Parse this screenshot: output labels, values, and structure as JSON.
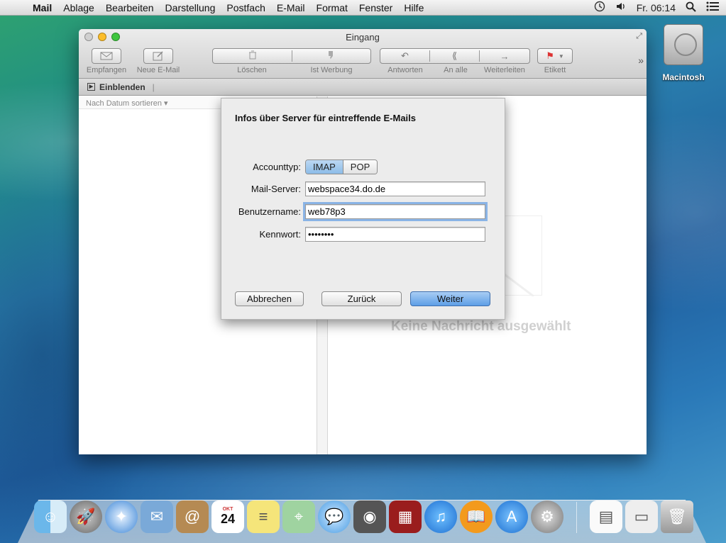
{
  "menubar": {
    "app_name": "Mail",
    "items": [
      "Ablage",
      "Bearbeiten",
      "Darstellung",
      "Postfach",
      "E-Mail",
      "Format",
      "Fenster",
      "Hilfe"
    ],
    "clock": "Fr. 06:14"
  },
  "desktop": {
    "hd_label": "Macintosh"
  },
  "window": {
    "title": "Eingang",
    "toolbar": {
      "receive": "Empfangen",
      "new_mail": "Neue E-Mail",
      "delete": "Löschen",
      "junk": "Ist Werbung",
      "reply": "Antworten",
      "reply_all": "An alle",
      "forward": "Weiterleiten",
      "flag": "Etikett"
    },
    "filter": "Einblenden",
    "sort": "Nach Datum sortieren ▾",
    "no_message": "Keine Nachricht ausgewählt"
  },
  "sheet": {
    "title": "Infos über Server für eintreffende E-Mails",
    "account_type_label": "Accounttyp:",
    "account_options": [
      "IMAP",
      "POP"
    ],
    "mail_server_label": "Mail-Server:",
    "mail_server_value": "webspace34.do.de",
    "username_label": "Benutzername:",
    "username_value": "web78p3",
    "password_label": "Kennwort:",
    "password_value": "••••••••",
    "cancel": "Abbrechen",
    "back": "Zurück",
    "next": "Weiter"
  },
  "dock": {
    "calendar_month": "OKT",
    "calendar_day": "24",
    "icons": [
      "finder-icon",
      "launchpad-icon",
      "safari-icon",
      "mail-icon",
      "contacts-icon",
      "calendar-icon",
      "notes-icon",
      "maps-icon",
      "messages-icon",
      "facetime-icon",
      "photobooth-icon",
      "itunes-icon",
      "ibooks-icon",
      "appstore-icon",
      "preferences-icon",
      "document-icon",
      "window-icon",
      "trash-icon"
    ]
  }
}
